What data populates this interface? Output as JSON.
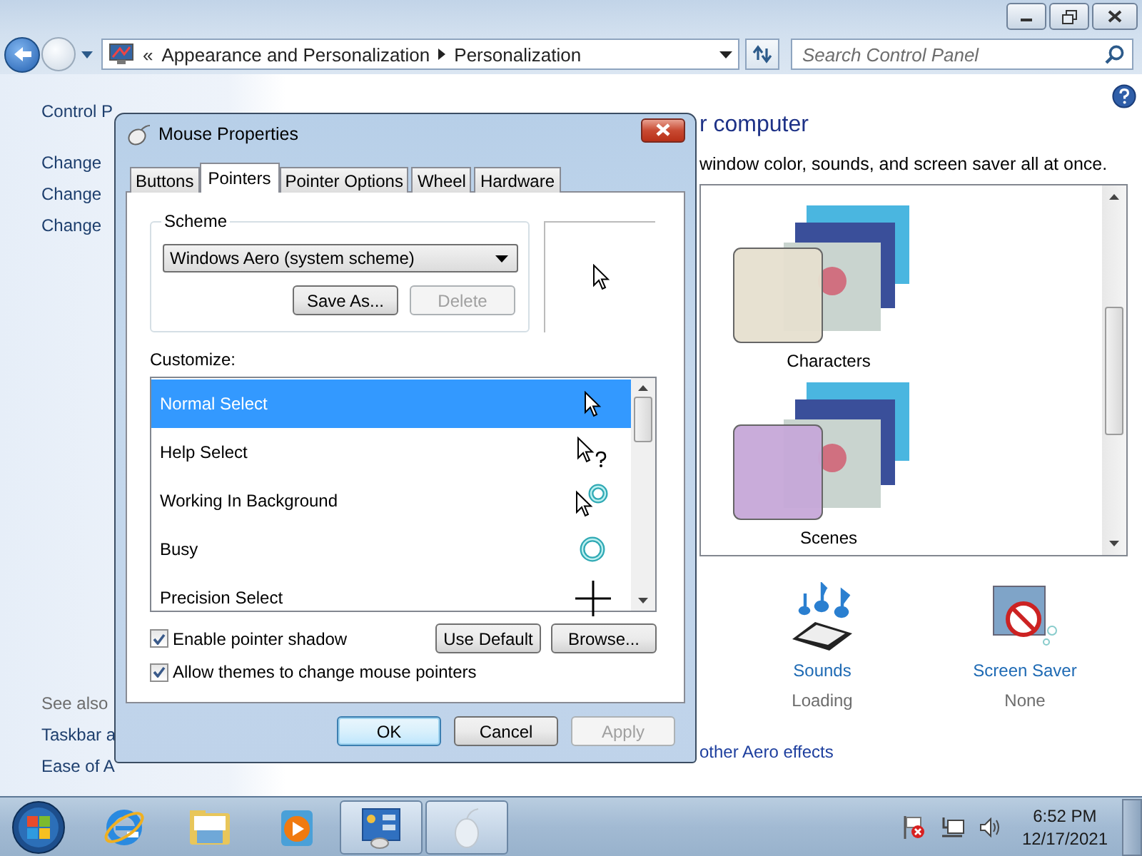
{
  "address_bar": {
    "prefix": "«",
    "breadcrumbs": [
      "Appearance and Personalization",
      "Personalization"
    ]
  },
  "search": {
    "placeholder": "Search Control Panel"
  },
  "sidebar": {
    "home_link": "Control P",
    "tasks": [
      "Change",
      "Change",
      "Change"
    ],
    "see_also_heading": "See also",
    "see_also": [
      "Taskbar a",
      "Ease of A"
    ]
  },
  "main": {
    "heading": "r computer",
    "description": "window color, sounds, and screen saver all at once.",
    "themes": [
      {
        "name": "Characters",
        "kind": "characters"
      },
      {
        "name": "Scenes",
        "kind": "scenes"
      }
    ],
    "settings": [
      {
        "label": "Sounds",
        "value": "Loading",
        "kind": "sounds"
      },
      {
        "label": "Screen Saver",
        "value": "None",
        "kind": "screensaver"
      }
    ],
    "aero_link": "other Aero effects"
  },
  "dialog": {
    "title": "Mouse Properties",
    "tabs": [
      {
        "label": "Buttons",
        "selected": false
      },
      {
        "label": "Pointers",
        "selected": true
      },
      {
        "label": "Pointer Options",
        "selected": false
      },
      {
        "label": "Wheel",
        "selected": false
      },
      {
        "label": "Hardware",
        "selected": false
      }
    ],
    "scheme": {
      "legend": "Scheme",
      "value": "Windows Aero (system scheme)",
      "buttons": [
        {
          "label": "Save As...",
          "disabled": false
        },
        {
          "label": "Delete",
          "disabled": true
        }
      ]
    },
    "customize_label": "Customize:",
    "pointers": [
      {
        "name": "Normal Select",
        "kind": "arrow",
        "selected": true
      },
      {
        "name": "Help Select",
        "kind": "help",
        "selected": false
      },
      {
        "name": "Working In Background",
        "kind": "working",
        "selected": false
      },
      {
        "name": "Busy",
        "kind": "busy",
        "selected": false
      },
      {
        "name": "Precision Select",
        "kind": "cross",
        "selected": false
      }
    ],
    "options": [
      {
        "label": "Enable pointer shadow",
        "checked": true
      },
      {
        "label": "Allow themes to change mouse pointers",
        "checked": true
      }
    ],
    "list_buttons": [
      "Use Default",
      "Browse..."
    ],
    "buttons": [
      {
        "label": "OK",
        "default": true,
        "disabled": false
      },
      {
        "label": "Cancel",
        "default": false,
        "disabled": false
      },
      {
        "label": "Apply",
        "default": false,
        "disabled": true
      }
    ]
  },
  "taskbar": {
    "apps": [
      {
        "kind": "ie",
        "active": false
      },
      {
        "kind": "explorer",
        "active": false
      },
      {
        "kind": "media",
        "active": false
      },
      {
        "kind": "control",
        "active": true
      },
      {
        "kind": "mouse",
        "active": true
      }
    ],
    "clock": {
      "time": "6:52 PM",
      "date": "12/17/2021"
    }
  }
}
